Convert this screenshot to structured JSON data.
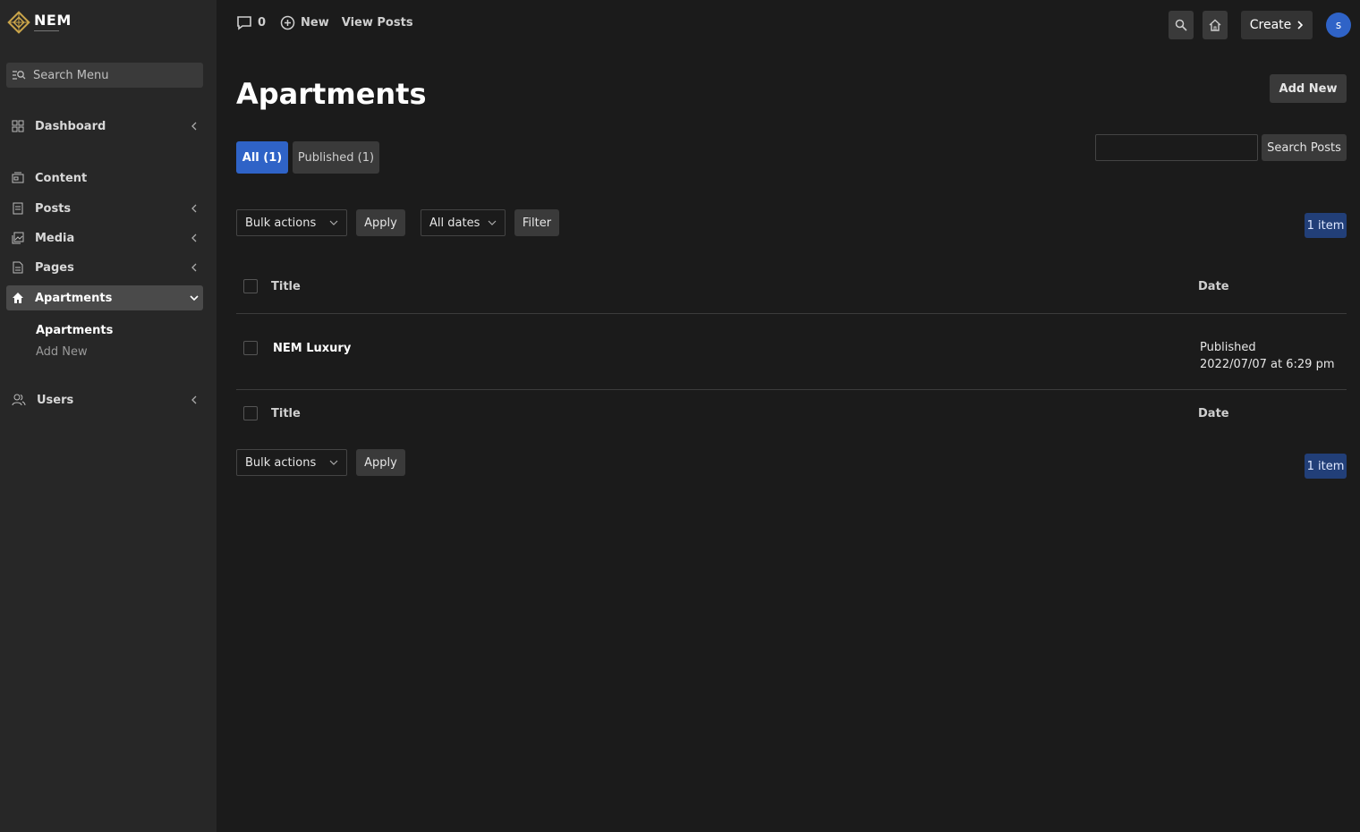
{
  "logo": {
    "text": "NEM"
  },
  "sidebar": {
    "search_placeholder": "Search Menu",
    "items": [
      {
        "label": "Dashboard"
      },
      {
        "label": "Content"
      },
      {
        "label": "Posts"
      },
      {
        "label": "Media"
      },
      {
        "label": "Pages"
      },
      {
        "label": "Apartments"
      },
      {
        "label": "Users"
      }
    ],
    "subitems": [
      {
        "label": "Apartments"
      },
      {
        "label": "Add New"
      }
    ]
  },
  "topbar": {
    "comments_count": "0",
    "new_label": "New",
    "view_posts_label": "View Posts",
    "create_label": "Create",
    "avatar_letter": "s"
  },
  "page": {
    "title": "Apartments",
    "add_new_label": "Add New",
    "tabs": [
      {
        "label": "All (1)"
      },
      {
        "label": "Published (1)"
      }
    ],
    "search_button": "Search Posts",
    "bulk_actions": "Bulk actions",
    "apply_label": "Apply",
    "all_dates": "All dates",
    "filter_label": "Filter",
    "item_count": "1 item"
  },
  "table": {
    "col_title": "Title",
    "col_date": "Date",
    "rows": [
      {
        "title": "NEM Luxury",
        "status": "Published",
        "date": "2022/07/07 at 6:29 pm"
      }
    ]
  },
  "colors": {
    "accent": "#2f63c7",
    "badge": "#223f78",
    "sidebar_bg": "#272727",
    "page_bg": "#1b1b1b"
  }
}
